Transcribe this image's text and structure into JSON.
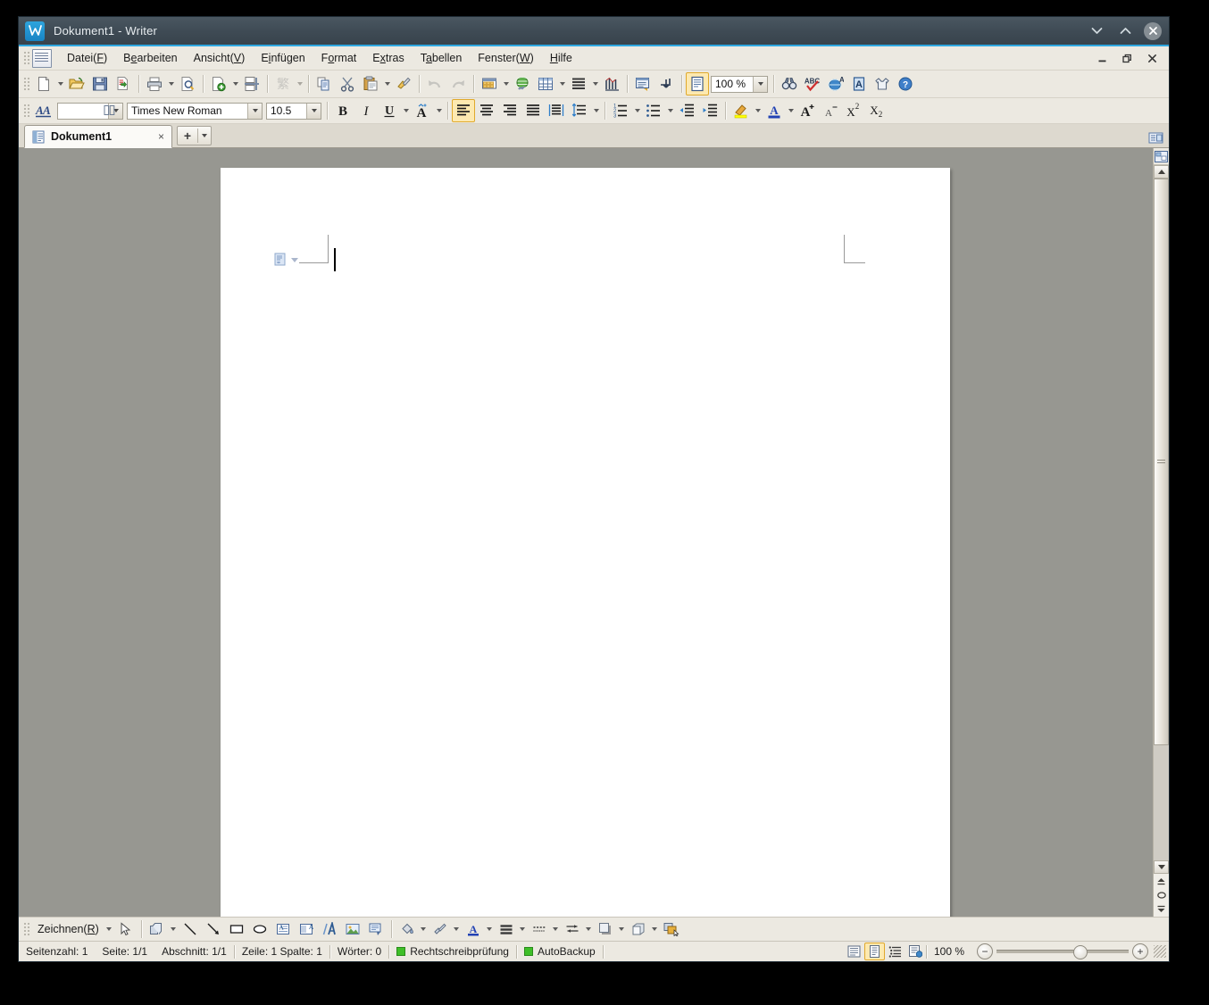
{
  "window": {
    "title": "Dokument1 - Writer",
    "app_icon": "writer-logo-icon",
    "controls": {
      "minimize_to_tray": "chevron-down-icon",
      "collapse_ribbon": "chevron-up-icon",
      "close": "close-icon"
    },
    "inner_controls": {
      "minimize": "minimize-icon",
      "restore": "restore-icon",
      "close": "close-icon"
    }
  },
  "menubar": {
    "items": [
      {
        "label": "Datei(F)",
        "pre": "Datei(",
        "accel": "F",
        "post": ")"
      },
      {
        "label": "Bearbeiten",
        "pre": "B",
        "accel": "e",
        "post": "arbeiten"
      },
      {
        "label": "Ansicht(V)",
        "pre": "Ansicht(",
        "accel": "V",
        "post": ")"
      },
      {
        "label": "Einfügen",
        "pre": "E",
        "accel": "i",
        "post": "nfügen"
      },
      {
        "label": "Format",
        "pre": "F",
        "accel": "o",
        "post": "rmat"
      },
      {
        "label": "Extras",
        "pre": "E",
        "accel": "x",
        "post": "tras"
      },
      {
        "label": "Tabellen",
        "pre": "T",
        "accel": "a",
        "post": "bellen"
      },
      {
        "label": "Fenster(W)",
        "pre": "Fenster(",
        "accel": "W",
        "post": ")"
      },
      {
        "label": "Hilfe",
        "pre": "",
        "accel": "H",
        "post": "ilfe"
      }
    ]
  },
  "toolbar_standard": {
    "items": [
      {
        "name": "new-document-icon",
        "tooltip": "Neu",
        "dropdown": true
      },
      {
        "name": "open-folder-icon",
        "tooltip": "Öffnen",
        "dropdown": false
      },
      {
        "name": "save-icon",
        "tooltip": "Speichern",
        "dropdown": false
      },
      {
        "name": "export-pdf-icon",
        "tooltip": "Als PDF exportieren",
        "dropdown": false
      },
      {
        "name": "print-icon",
        "tooltip": "Drucken",
        "dropdown": true
      },
      {
        "name": "print-preview-icon",
        "tooltip": "Seitenansicht",
        "dropdown": false
      },
      {
        "name": "new-from-template-icon",
        "tooltip": "Neu aus Vorlage",
        "dropdown": true
      },
      {
        "name": "split-page-icon",
        "tooltip": "Seite teilen",
        "dropdown": false
      },
      {
        "name": "traditional-chinese-icon",
        "tooltip": "Chinesische Umwandlung",
        "dropdown": true,
        "disabled": true
      },
      {
        "name": "copy-icon",
        "tooltip": "Kopieren",
        "dropdown": false
      },
      {
        "name": "cut-icon",
        "tooltip": "Ausschneiden",
        "dropdown": false
      },
      {
        "name": "paste-icon",
        "tooltip": "Einfügen",
        "dropdown": true
      },
      {
        "name": "format-paintbrush-icon",
        "tooltip": "Format übertragen",
        "dropdown": false
      },
      {
        "name": "undo-icon",
        "tooltip": "Rückgängig",
        "dropdown": false,
        "disabled": true
      },
      {
        "name": "redo-icon",
        "tooltip": "Wiederholen",
        "dropdown": false,
        "disabled": true
      },
      {
        "name": "insert-table-grid-icon",
        "tooltip": "Tabelle einfügen",
        "dropdown": true
      },
      {
        "name": "hyperlink-icon",
        "tooltip": "Hyperlink",
        "dropdown": false
      },
      {
        "name": "table-icon",
        "tooltip": "Tabelle",
        "dropdown": true
      },
      {
        "name": "paragraph-lines-icon",
        "tooltip": "Absatz",
        "dropdown": true
      },
      {
        "name": "chart-columns-icon",
        "tooltip": "Diagramm",
        "dropdown": false
      },
      {
        "name": "comment-icon",
        "tooltip": "Kommentar einfügen",
        "dropdown": false
      },
      {
        "name": "formatting-marks-icon",
        "tooltip": "Formatierungszeichen",
        "dropdown": false,
        "active": false
      }
    ],
    "web_layout_button": {
      "name": "web-layout-icon",
      "active": true
    },
    "zoom_combo": {
      "value": "100 %",
      "name": "zoom-combo"
    },
    "right_items": [
      {
        "name": "find-binoculars-icon",
        "tooltip": "Suchen und Ersetzen"
      },
      {
        "name": "spellcheck-abc-icon",
        "tooltip": "Rechtschreibprüfung"
      },
      {
        "name": "translate-globe-icon",
        "tooltip": "Übersetzen"
      },
      {
        "name": "text-box-a-icon",
        "tooltip": "Textrahmen"
      },
      {
        "name": "shirt-icon",
        "tooltip": "Design"
      },
      {
        "name": "help-question-icon",
        "tooltip": "Hilfe"
      }
    ]
  },
  "toolbar_format": {
    "style_apply_icon": "apply-style-aa-icon",
    "style_combo": {
      "value": "",
      "name": "paragraph-style-combo",
      "icon": "columns-icon"
    },
    "font_combo": {
      "value": "Times New Roman",
      "name": "font-name-combo"
    },
    "size_combo": {
      "value": "10.5",
      "name": "font-size-combo"
    },
    "buttons": [
      {
        "name": "bold-button",
        "glyph": "B",
        "dropdown": false
      },
      {
        "name": "italic-button",
        "glyph": "I",
        "dropdown": false
      },
      {
        "name": "underline-button",
        "glyph": "U",
        "dropdown": true
      },
      {
        "name": "character-highlight-a-icon",
        "glyph": "A",
        "dropdown": true
      },
      {
        "name": "align-left-button",
        "active": true
      },
      {
        "name": "align-center-button",
        "active": false
      },
      {
        "name": "align-right-button",
        "active": false
      },
      {
        "name": "align-justify-button",
        "active": false
      },
      {
        "name": "align-distributed-button",
        "active": false
      },
      {
        "name": "line-spacing-button",
        "dropdown": true
      },
      {
        "name": "ordered-list-button",
        "dropdown": true
      },
      {
        "name": "unordered-list-button",
        "dropdown": true
      },
      {
        "name": "decrease-indent-button",
        "dropdown": false
      },
      {
        "name": "increase-indent-button",
        "dropdown": false
      },
      {
        "name": "highlight-color-button",
        "dropdown": true,
        "color": "#ffff00"
      },
      {
        "name": "font-color-button",
        "dropdown": true,
        "color": "#2242b4"
      },
      {
        "name": "increase-font-size-button"
      },
      {
        "name": "decrease-font-size-button"
      },
      {
        "name": "superscript-button"
      },
      {
        "name": "subscript-button"
      }
    ]
  },
  "tabbar": {
    "tabs": [
      {
        "label": "Dokument1",
        "icon": "document-icon",
        "close": "×",
        "active": true
      }
    ],
    "new_tab_button": {
      "plus": "+",
      "name": "new-tab-button"
    },
    "right_icon": "tab-list-icon"
  },
  "document": {
    "paragraph_mark_icon": "paragraph-object-icon",
    "cursor": "text-caret"
  },
  "toolbar_drawing": {
    "label": "Zeichnen(R)",
    "label_pre": "Zeichnen(",
    "label_accel": "R",
    "label_post": ")",
    "items": [
      {
        "name": "select-arrow-icon"
      },
      {
        "name": "basic-shapes-icon",
        "dropdown": true
      },
      {
        "name": "line-icon"
      },
      {
        "name": "arrow-line-icon"
      },
      {
        "name": "rectangle-icon"
      },
      {
        "name": "ellipse-icon"
      },
      {
        "name": "text-box-icon"
      },
      {
        "name": "vertical-text-box-icon"
      },
      {
        "name": "fontwork-icon"
      },
      {
        "name": "insert-image-icon"
      },
      {
        "name": "callout-icon"
      },
      {
        "name": "fill-color-icon",
        "dropdown": true
      },
      {
        "name": "line-color-icon",
        "dropdown": true
      },
      {
        "name": "font-color-icon",
        "dropdown": true,
        "color": "#2242b4"
      },
      {
        "name": "line-width-icon",
        "dropdown": true
      },
      {
        "name": "line-style-icon",
        "dropdown": true
      },
      {
        "name": "arrow-style-icon",
        "dropdown": true
      },
      {
        "name": "shadow-icon",
        "dropdown": true
      },
      {
        "name": "3d-effects-icon",
        "dropdown": true
      },
      {
        "name": "arrange-objects-icon"
      }
    ]
  },
  "statusbar": {
    "page_count": "Seitenzahl: 1",
    "page_of": "Seite: 1/1",
    "section": "Abschnitt: 1/1",
    "line_col": "Zeile: 1  Spalte: 1",
    "words": "Wörter: 0",
    "spellcheck": "Rechtschreibprüfung",
    "autobackup": "AutoBackup",
    "view_buttons": [
      {
        "name": "view-normal-button",
        "selected": false
      },
      {
        "name": "view-print-layout-button",
        "selected": true
      },
      {
        "name": "view-outline-button",
        "selected": false
      },
      {
        "name": "view-web-layout-button",
        "selected": false
      }
    ],
    "zoom_value": "100 %",
    "zoom_out": "−",
    "zoom_in": "+"
  },
  "colors": {
    "titlebar": "#3f4b55",
    "accent": "#2fa8e0",
    "toolbar_bg": "#ece9e1",
    "canvas_bg": "#979791",
    "page_bg": "#ffffff",
    "status_green": "#3fbf28",
    "highlight": "#fde9b0"
  }
}
